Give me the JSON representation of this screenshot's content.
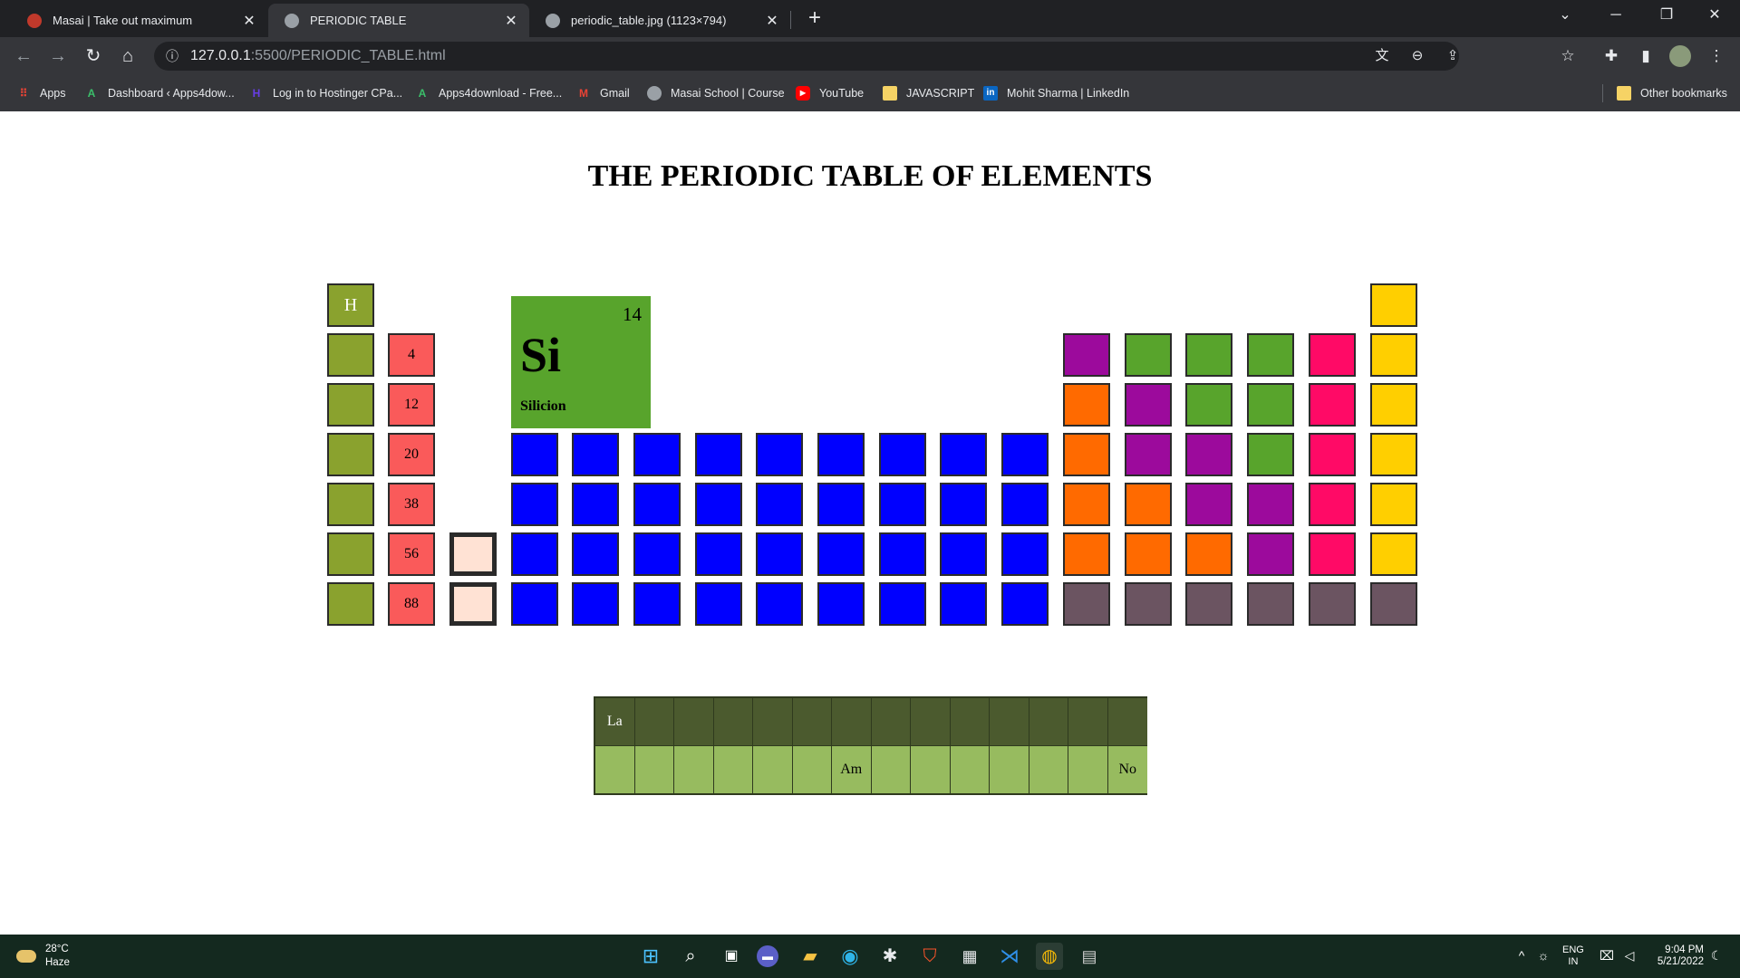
{
  "browser": {
    "tabs": [
      {
        "title": "Masai | Take out maximum",
        "active": false,
        "favicon_color": "#c0392b"
      },
      {
        "title": "PERIODIC TABLE",
        "active": true,
        "favicon_color": "#9aa0a6"
      },
      {
        "title": "periodic_table.jpg (1123×794)",
        "active": false,
        "favicon_color": "#9aa0a6"
      }
    ],
    "new_tab_icon": "+",
    "window_controls": {
      "dropdown": "⌄",
      "minimize": "─",
      "restore": "❐",
      "close": "✕"
    },
    "url": {
      "host": "127.0.0.1",
      "path": ":5500/PERIODIC_TABLE.html"
    },
    "bookmarks": [
      {
        "label": "Apps",
        "icon": "apps-grid-icon",
        "color": "#ea4335"
      },
      {
        "label": "Dashboard ‹ Apps4dow...",
        "icon": "apps4download-icon",
        "color": "#3bbf6a"
      },
      {
        "label": "Log in to Hostinger CPa...",
        "icon": "hostinger-icon",
        "color": "#673de6"
      },
      {
        "label": "Apps4download - Free...",
        "icon": "apps4download-icon",
        "color": "#3bbf6a"
      },
      {
        "label": "Gmail",
        "icon": "gmail-icon",
        "color": "#ea4335"
      },
      {
        "label": "Masai School | Course",
        "icon": "globe-icon",
        "color": "#9aa0a6"
      },
      {
        "label": "YouTube",
        "icon": "youtube-icon",
        "color": "#ff0000"
      },
      {
        "label": "JAVASCRIPT",
        "icon": "folder-icon",
        "color": "#f6d365"
      },
      {
        "label": "Mohit Sharma | LinkedIn",
        "icon": "linkedin-icon",
        "color": "#0a66c2"
      }
    ],
    "other_bookmarks": "Other bookmarks"
  },
  "page": {
    "title": "THE PERIODIC TABLE OF ELEMENTS",
    "featured_element": {
      "number": "14",
      "symbol": "Si",
      "name": "Silicion"
    },
    "colors": {
      "hydrogen": "#8aa22e",
      "alkali": "#8aa22e",
      "alkaline_earth": "#fa5a5a",
      "series_placeholder": "#ffe2d4",
      "transition": "#0000ff",
      "post_transition": "#ff6a00",
      "metalloid": "#9c0a9c",
      "nonmetal": "#58a42c",
      "halogen": "#ff0a66",
      "noble_gas": "#ffcf00",
      "unknown": "#6b5461",
      "lanthanide": "#4b5a2e",
      "actinide": "#97bb5f"
    },
    "cells": {
      "h": "H",
      "be": "4",
      "mg": "12",
      "ca": "20",
      "sr": "38",
      "ba": "56",
      "ra": "88"
    },
    "series": {
      "lanthanides": [
        "La",
        "",
        "",
        "",
        "",
        "",
        "",
        "",
        "",
        "",
        "",
        "",
        "",
        ""
      ],
      "actinides": [
        "",
        "",
        "",
        "",
        "",
        "",
        "Am",
        "",
        "",
        "",
        "",
        "",
        "",
        "No"
      ]
    }
  },
  "taskbar": {
    "weather": {
      "temp": "28°C",
      "condition": "Haze"
    },
    "lang": {
      "line1": "ENG",
      "line2": "IN"
    },
    "clock": {
      "time": "9:04 PM",
      "date": "5/21/2022"
    }
  }
}
